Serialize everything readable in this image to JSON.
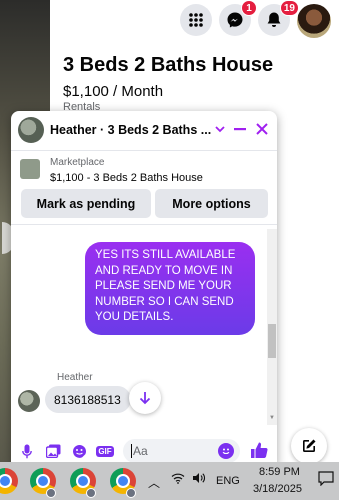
{
  "header": {
    "messenger_badge": "1",
    "notifications_badge": "19"
  },
  "listing": {
    "title": "3 Beds 2 Baths House",
    "price": "$1,100 / Month",
    "category": "Rentals"
  },
  "chat": {
    "title": "Heather · 3 Beds 2 Baths ...",
    "marketplace_label": "Marketplace",
    "item": "$1,100 - 3 Beds 2 Baths House",
    "mark_pending_label": "Mark as pending",
    "more_options_label": "More options",
    "outgoing_message": "YES ITS STILL AVAILABLE AND READY TO MOVE IN PLEASE SEND ME YOUR NUMBER SO I CAN SEND YOU DETAILS.",
    "sender_name": "Heather",
    "incoming_message": "8136188513",
    "input_placeholder": "Aa",
    "gif_label": "GIF"
  },
  "taskbar": {
    "language": "ENG",
    "time": "8:59 PM",
    "date": "3/18/2025"
  },
  "colors": {
    "accent": "#a020f0",
    "bubble": "#8b30f0",
    "badge": "#e41e3f",
    "facebook_blue": "#0866ff"
  }
}
